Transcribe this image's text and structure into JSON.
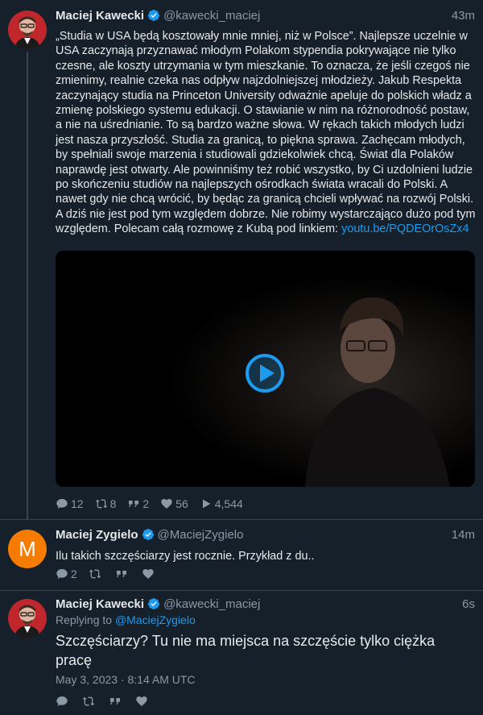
{
  "tweets": [
    {
      "name": "Maciej Kawecki",
      "handle": "@kawecki_maciej",
      "time": "43m",
      "text": "„Studia w USA będą kosztowały mnie mniej, niż w Polsce”. Najlepsze uczelnie w USA zaczynają przyznawać młodym Polakom stypendia pokrywające nie tylko czesne, ale koszty utrzymania w tym mieszkanie. To oznacza, że jeśli czegoś nie zmienimy, realnie czeka nas odpływ najzdolniejszej młodzieży. Jakub Respekta zaczynający studia na Princeton University odważnie apeluje do polskich władz a zmienę polskiego systemu edukacji. O stawianie w nim na różnorodność postaw, a nie na uśrednianie. To są bardzo ważne słowa. W rękach takich młodych ludzi jest nasza przyszłość. Studia za granicą, to piękna sprawa. Zachęcam młodych, by spełniali swoje marzenia i studiowali gdziekolwiek chcą. Świat dla Polaków naprawdę jest otwarty. Ale powinniśmy też robić wszystko, by Ci uzdolnieni ludzie po skończeniu studiów na najlepszych ośrodkach świata wracali do Polski. A nawet gdy nie chcą wrócić, by będąc za granicą chcieli wpływać na rozwój Polski. A dziś nie jest pod tym względem dobrze. Nie robimy wystarczająco dużo pod tym względem. Polecam całą rozmowę z Kubą pod linkiem: ",
      "link": "youtu.be/PQDEOrOsZx4",
      "stats": {
        "replies": "12",
        "retweets": "8",
        "quotes": "2",
        "likes": "56",
        "views": "4,544"
      }
    },
    {
      "name": "Maciej Zygielo",
      "handle": "@MaciejZygielo",
      "time": "14m",
      "avatar_letter": "M",
      "text": "Ilu takich szczęściarzy jest rocznie. Przykład z du..",
      "stats": {
        "replies": "2"
      }
    },
    {
      "name": "Maciej Kawecki",
      "handle": "@kawecki_maciej",
      "time": "6s",
      "replying_prefix": "Replying to ",
      "replying_to": "@MaciejZygielo",
      "text": "Szczęściarzy? Tu nie ma miejsca na szczęście tylko ciężka pracę",
      "date": "May 3, 2023 · 8:14 AM UTC"
    }
  ],
  "colors": {
    "background": "#15202b",
    "accent": "#1d9bf0",
    "muted": "#8b98a5",
    "avatar_orange": "#f57c00"
  },
  "icons": [
    "verified-icon",
    "reply-icon",
    "retweet-icon",
    "quote-icon",
    "like-icon",
    "views-icon",
    "play-icon"
  ]
}
